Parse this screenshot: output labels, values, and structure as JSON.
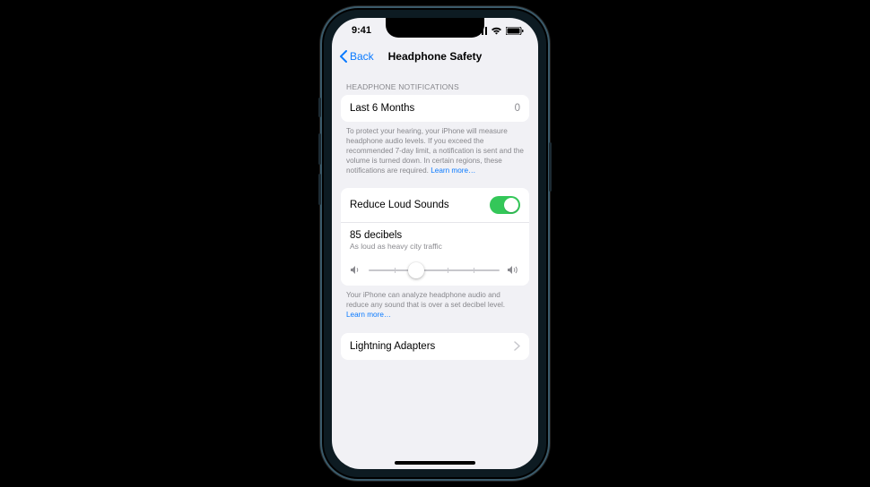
{
  "statusbar": {
    "time": "9:41"
  },
  "navbar": {
    "back_label": "Back",
    "title": "Headphone Safety"
  },
  "sections": {
    "notifications": {
      "header": "HEADPHONE NOTIFICATIONS",
      "row_label": "Last 6 Months",
      "row_value": "0",
      "footer_text": "To protect your hearing, your iPhone will measure headphone audio levels. If you exceed the recommended 7-day limit, a notification is sent and the volume is turned down. In certain regions, these notifications are required. ",
      "footer_link": "Learn more…"
    },
    "reduce": {
      "toggle_label": "Reduce Loud Sounds",
      "toggle_on": true,
      "decibel_value": "85 decibels",
      "decibel_desc": "As loud as heavy city traffic",
      "slider_percent": 36,
      "footer_text": "Your iPhone can analyze headphone audio and reduce any sound that is over a set decibel level. ",
      "footer_link": "Learn more…"
    },
    "adapters": {
      "label": "Lightning Adapters"
    }
  },
  "colors": {
    "accent_blue": "#0a7aff",
    "toggle_green": "#34c759"
  }
}
